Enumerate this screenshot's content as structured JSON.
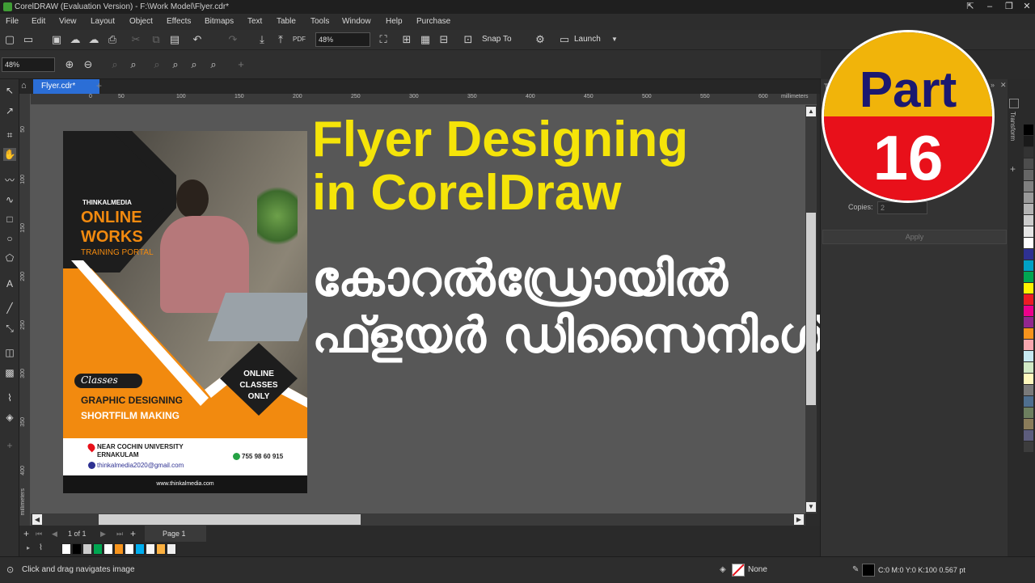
{
  "window": {
    "title": "CorelDRAW (Evaluation Version) - F:\\Work Model\\Flyer.cdr*"
  },
  "menu": [
    "File",
    "Edit",
    "View",
    "Layout",
    "Object",
    "Effects",
    "Bitmaps",
    "Text",
    "Table",
    "Tools",
    "Window",
    "Help",
    "Purchase"
  ],
  "toolbar": {
    "zoom_value": "48%",
    "snap_to_label": "Snap To",
    "launch_label": "Launch",
    "zoom_small": "48%"
  },
  "document": {
    "tab_label": "Flyer.cdr*"
  },
  "ruler": {
    "ticks": [
      "0",
      "50",
      "100",
      "150",
      "200",
      "250",
      "300",
      "350",
      "400",
      "450",
      "500",
      "550",
      "600"
    ],
    "units": "millimeters",
    "v_ticks": [
      "50",
      "100",
      "150",
      "200",
      "250",
      "300",
      "350",
      "400"
    ],
    "v_units": "millimeters"
  },
  "flyer": {
    "brand": "THINKALMEDIA",
    "headline1": "ONLINE",
    "headline2": "WORKS",
    "subheadline": "TRAINING PORTAL",
    "classes_script": "Classes",
    "course1": "GRAPHIC DESIGNING",
    "course2": "SHORTFILM MAKING",
    "badge_line1": "ONLINE",
    "badge_line2": "CLASSES",
    "badge_line3": "ONLY",
    "address1": "NEAR COCHIN UNIVERSITY",
    "address2": "ERNAKULAM",
    "email": "thinkalmedia2020@gmail.com",
    "phone": "755 98 60 915",
    "website": "www.thinkalmedia.com"
  },
  "overlay": {
    "title_en_line1": "Flyer Designing",
    "title_en_line2": "in CorelDraw",
    "title_ml_line1": "കോറൽഡ്രോയിൽ",
    "title_ml_line2": "ഫ്ളയർ ഡിസൈനിംഗ്",
    "part_label": "Part",
    "part_number": "16"
  },
  "pagebar": {
    "page_counter": "1 of 1",
    "page_tab": "Page 1"
  },
  "docker": {
    "tab_label": "Transform",
    "copies_label": "Copies:",
    "copies_value": "2",
    "apply_label": "Apply"
  },
  "status": {
    "hint": "Click and drag navigates image",
    "fill_label": "None",
    "color_info": "C:0 M:0 Y:0 K:100  0.567 pt"
  },
  "palette_colors": [
    "#ffffff",
    "#000000",
    "#cccccc",
    "#00a651",
    "#ffffff",
    "#f7941d",
    "#ffffff",
    "#00aeef",
    "#f7f7f7",
    "#fbb040",
    "#eeeeee"
  ],
  "side_palette_colors": [
    "#000000",
    "#1a1a1a",
    "#333333",
    "#4d4d4d",
    "#666666",
    "#808080",
    "#999999",
    "#b3b3b3",
    "#cccccc",
    "#e6e6e6",
    "#ffffff",
    "#2e3192",
    "#00a0c6",
    "#00a651",
    "#fff200",
    "#ed1c24",
    "#ec008c",
    "#92278f",
    "#f7941d",
    "#f9a7b0",
    "#c7e9f1",
    "#d1e9c5",
    "#fff9bd",
    "#7a7a7a",
    "#4f6f8f",
    "#6d7f5f",
    "#8a7c5a",
    "#5d5d7d",
    "#3c3c3c"
  ]
}
